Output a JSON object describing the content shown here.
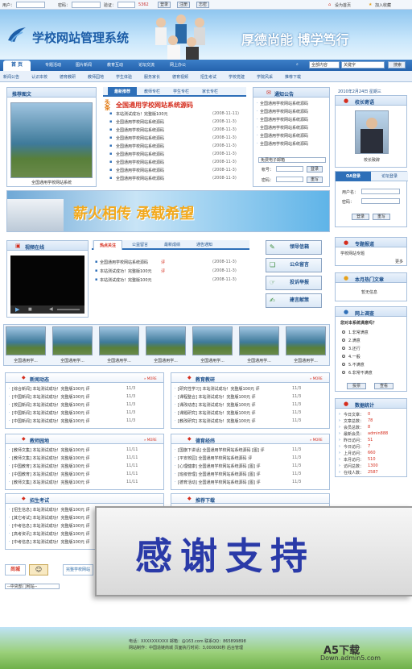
{
  "login_bar": {
    "user_label": "用户：",
    "password_label": "密码：",
    "code_label": "验证：",
    "code_value": "5362",
    "login_btn": "登录",
    "register_btn": "注册",
    "forgot_btn": "忘密",
    "set_home": "设为首页",
    "add_fav": "加入收藏"
  },
  "banner": {
    "logo_text": "学校网站管理系统",
    "motto": "厚德尚能 博学笃行"
  },
  "nav": {
    "home": "首 页",
    "items": [
      "专题活动",
      "图片新闻",
      "教育互动",
      "论坛交流",
      "网上办公"
    ],
    "search_scope": "全部内容",
    "search_value": "关键字",
    "search_btn": "搜索"
  },
  "subnav": {
    "items": [
      "新闻公告",
      "认识本校",
      "德育教研",
      "教师园地",
      "学生体验",
      "服务家长",
      "德育视频",
      "招生考试",
      "学校党建",
      "学院风采",
      "推荐下载"
    ]
  },
  "recommend_pics": {
    "title": "推荐图文",
    "caption": "全国通用学校网站系统"
  },
  "headlines": {
    "tabs": [
      "最新推荐",
      "教师专栏",
      "学生专栏",
      "家长专栏"
    ],
    "top_badge": "头条",
    "top_title": "全国通用学校网站系统源码",
    "first_item": "本站测试成功！完整版100元",
    "items": [
      {
        "text": "本站测试成功！完整版100元",
        "date": "(2008-11-11)"
      },
      {
        "text": "全国通用学校网站系统源码",
        "date": "(2008-11-3)"
      },
      {
        "text": "全国通用学校网站系统源码",
        "date": "(2008-11-3)"
      },
      {
        "text": "全国通用学校网站系统源码",
        "date": "(2008-11-3)"
      },
      {
        "text": "全国通用学校网站系统源码",
        "date": "(2008-11-3)"
      },
      {
        "text": "全国通用学校网站系统源码",
        "date": "(2008-11-3)"
      },
      {
        "text": "全国通用学校网站系统源码",
        "date": "(2008-11-3)"
      },
      {
        "text": "全国通用学校网站系统源码",
        "date": "(2008-11-3)"
      },
      {
        "text": "全国通用学校网站系统源码",
        "date": "(2008-11-3)"
      }
    ]
  },
  "notices": {
    "title": "通知公告",
    "items": [
      "全国通用学校网站系统源码",
      "全国通用学校网站系统源码",
      "全国通用学校网站系统源码",
      "全国通用学校网站系统源码",
      "全国通用学校网站系统源码",
      "全国通用学校网站系统源码"
    ],
    "mail_select": "免费电子邮箱",
    "account_label": "帐号：",
    "password_label": "密码：",
    "login_btn": "登录",
    "reset_btn": "重写"
  },
  "right_top": {
    "date": "2010年2月24日 星期三",
    "principal_title": "校长寄语",
    "principal_caption": "校长致辞",
    "oa_tab": "OA登录",
    "forum_tab": "论坛登录",
    "user_label": "用户名：",
    "pw_label": "密码：",
    "login_btn": "登录",
    "reset_btn": "重写"
  },
  "promo_banner": {
    "text": "薪火相传 承载希望"
  },
  "video": {
    "title": "视频在线"
  },
  "focus": {
    "tabs": [
      "热点关注",
      "公益留言",
      "最新成绩",
      "通告通知"
    ],
    "items": [
      {
        "text": "全国通用学校网站系统源码",
        "tag": "评",
        "date": "(2008-11-3)"
      },
      {
        "text": "本站测试成功！完整版100元",
        "tag": "评",
        "date": "(2008-11-3)"
      },
      {
        "text": "本站测试成功！完整版100元",
        "tag": "",
        "date": "(2008-11-3)"
      }
    ]
  },
  "service_buttons": [
    "领导信箱",
    "公众留言",
    "投诉举报",
    "建言献策"
  ],
  "special": {
    "title": "专题报道",
    "item": "学校网站专题",
    "more": "更多"
  },
  "hot": {
    "title": "本月热门文章",
    "empty": "暂无信息"
  },
  "survey": {
    "title": "网上调查",
    "question": "您对本系统满意吗？",
    "options": [
      "1.非常满意",
      "2.满意",
      "3.还行",
      "4.一般",
      "5.不满意",
      "6.非常不满意"
    ],
    "vote_btn": "投票",
    "view_btn": "查看"
  },
  "stats": {
    "title": "数据统计",
    "rows": [
      {
        "label": "今日文章：",
        "value": "0"
      },
      {
        "label": "文章总数：",
        "value": "78"
      },
      {
        "label": "会员总数：",
        "value": "8"
      },
      {
        "label": "最新会员：",
        "value": "admin888"
      },
      {
        "label": "昨日访问：",
        "value": "51"
      },
      {
        "label": "今日访问：",
        "value": "7"
      },
      {
        "label": "上月访问：",
        "value": "660"
      },
      {
        "label": "本月访问：",
        "value": "510"
      },
      {
        "label": "访问总数：",
        "value": "1300"
      },
      {
        "label": "在线人数：",
        "value": "2587"
      }
    ]
  },
  "gallery": {
    "captions": [
      "全国通用学...",
      "全国通用学...",
      "全国通用学...",
      "全国通用学...",
      "全国通用学...",
      "全国通用学...",
      "全国通用学..."
    ]
  },
  "sections": [
    {
      "title": "新闻动态",
      "more": "» MORE",
      "rows": [
        {
          "text": "[综合新闻] 本站测试成功！完整版100元 评",
          "date": "11/3"
        },
        {
          "text": "[中国新闻] 本站测试成功！完整版100元 评",
          "date": "11/3"
        },
        {
          "text": "[校园新闻] 本站测试成功！完整版100元 评",
          "date": "11/3"
        },
        {
          "text": "[中国新闻] 本站测试成功！完整版100元 评",
          "date": "11/3"
        },
        {
          "text": "[中国新闻] 本站测试成功！完整版100元 评",
          "date": "11/3"
        }
      ]
    },
    {
      "title": "教育教研",
      "more": "» MORE",
      "rows": [
        {
          "text": "[研究性学习] 本站测试成功！完整版100元 评",
          "date": "11/3"
        },
        {
          "text": "[课程整合] 本站测试成功！完整版100元 评",
          "date": "11/3"
        },
        {
          "text": "[课改动态] 本站测试成功！完整版100元 评",
          "date": "11/3"
        },
        {
          "text": "[课题研究] 本站测试成功！完整版100元 评",
          "date": "11/3"
        },
        {
          "text": "[教改研究] 本站测试成功！完整版100元 评",
          "date": "11/3"
        }
      ]
    },
    {
      "title": "教师园地",
      "more": "» MORE",
      "rows": [
        {
          "text": "[教师文集] 本站测试成功！完整版100元 评",
          "date": "11/11"
        },
        {
          "text": "[教师文集] 本站测试成功！完整版100元 评",
          "date": "11/11"
        },
        {
          "text": "[中国教育] 本站测试成功！完整版100元 评",
          "date": "11/11"
        },
        {
          "text": "[中国教育] 本站测试成功！完整版100元 评",
          "date": "11/11"
        },
        {
          "text": "[教师文集] 本站测试成功！完整版100元 评",
          "date": "11/11"
        }
      ]
    },
    {
      "title": "德育经纬",
      "more": "» MORE",
      "rows": [
        {
          "text": "[国旗下讲话] 全国通用学校网站系统源码 [图] 评",
          "date": "11/3"
        },
        {
          "text": "[平安校园] 全国通用学校网站系统源码 评",
          "date": "11/3"
        },
        {
          "text": "[心理健康] 全国通用学校网站系统源码 [图] 评",
          "date": "11/3"
        },
        {
          "text": "[班级管理] 全国通用学校网站系统源码 [图] 评",
          "date": "11/3"
        },
        {
          "text": "[德育活动] 全国通用学校网站系统源码 [图] 评",
          "date": "11/3"
        }
      ]
    },
    {
      "title": "招生考试",
      "more": "",
      "rows": [
        {
          "text": "[招生信息] 本站测试成功！完整版100元 评",
          "date": "11/3"
        },
        {
          "text": "[其它考试] 本站测试成功！完整版100元 评",
          "date": "11/3"
        },
        {
          "text": "[中考信息] 本站测试成功！完整版100元 评",
          "date": "11/3"
        },
        {
          "text": "[高考资讯] 本站测试成功！完整版100元 评",
          "date": "11/3"
        },
        {
          "text": "[中考信息] 本站测试成功！完整版100元 评",
          "date": "11/3"
        }
      ]
    },
    {
      "title": "推荐下载",
      "more": "",
      "rows": []
    }
  ],
  "links": {
    "select": "--中央部门网站--",
    "logo1": "尚城",
    "logo2": "完整学校网站"
  },
  "thanks_text": "感谢支持",
  "footer": {
    "line1": "电话：XXXXXXXXXX 邮箱：@163.com 联系QQ：865899898",
    "line2": "网站制作：中国造链商城 页面执行时间：3,000000秒 后台管理",
    "brand": "A5下载",
    "brand_url": "Down.admin5.com"
  }
}
